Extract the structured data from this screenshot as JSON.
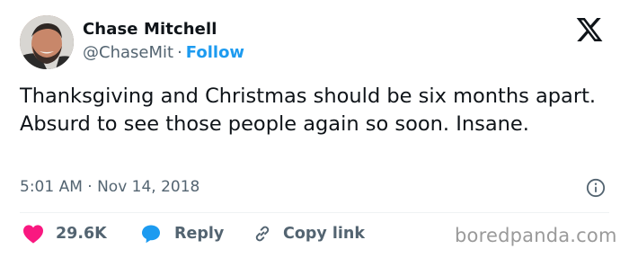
{
  "author": {
    "name": "Chase Mitchell",
    "handle": "@ChaseMit",
    "separator": "·",
    "follow_label": "Follow"
  },
  "tweet": {
    "text": "Thanksgiving and Christmas should be six months apart. Absurd to see those people again so soon. Insane.",
    "timestamp": "5:01 AM · Nov 14, 2018"
  },
  "actions": {
    "like_count": "29.6K",
    "reply_label": "Reply",
    "copy_link_label": "Copy link"
  },
  "watermark": "boredpanda.com",
  "icons": {
    "brand": "x-logo-icon",
    "info": "info-icon",
    "like": "heart-icon",
    "reply": "speech-bubble-icon",
    "copy": "link-icon"
  },
  "colors": {
    "accent": "#1d9bf0",
    "like": "#f91880",
    "text": "#0f1419",
    "muted": "#536471",
    "divider": "#eff3f4",
    "watermark": "#9a9a9a"
  }
}
